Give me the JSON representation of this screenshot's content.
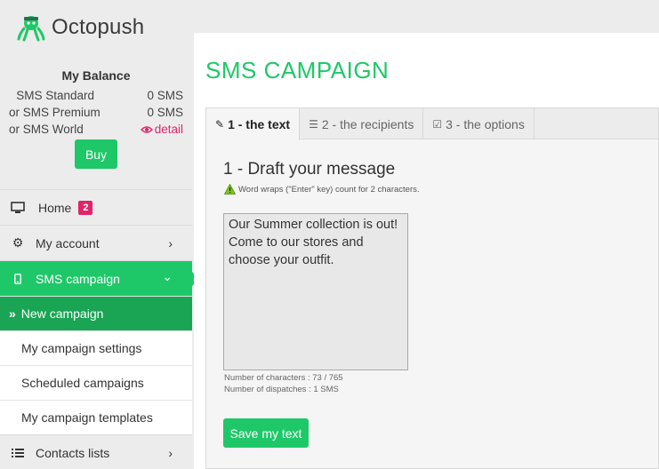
{
  "brand": {
    "name": "Octopush"
  },
  "balance": {
    "title": "My Balance",
    "rows": [
      {
        "label": "SMS Standard",
        "value": "0 SMS"
      },
      {
        "label": "or SMS Premium",
        "value": "0 SMS"
      },
      {
        "label": "or SMS World",
        "value": "detail"
      }
    ],
    "buy_label": "Buy"
  },
  "nav": {
    "home": {
      "label": "Home",
      "badge": "2"
    },
    "account": {
      "label": "My account"
    },
    "sms_campaign": {
      "label": "SMS campaign"
    },
    "sub": {
      "new_campaign": "New campaign",
      "settings": "My campaign settings",
      "scheduled": "Scheduled campaigns",
      "templates": "My campaign templates"
    },
    "contacts": {
      "label": "Contacts lists"
    }
  },
  "main": {
    "title": "SMS CAMPAIGN",
    "tabs": [
      {
        "label": "1 - the text"
      },
      {
        "label": "2 - the recipients"
      },
      {
        "label": "3 - the options"
      }
    ],
    "draft_title": "1 - Draft your message",
    "hint": "Word wraps (\"Enter\" key) count for 2 characters.",
    "message": "Our Summer collection is out! Come to our stores and choose your outfit.",
    "characters": "Number of characters : 73 / 765",
    "dispatches": "Number of dispatches : 1 SMS",
    "save_label": "Save my text"
  },
  "colors": {
    "accent": "#1ec868",
    "accent_dark": "#19a554",
    "badge": "#e0246b"
  }
}
